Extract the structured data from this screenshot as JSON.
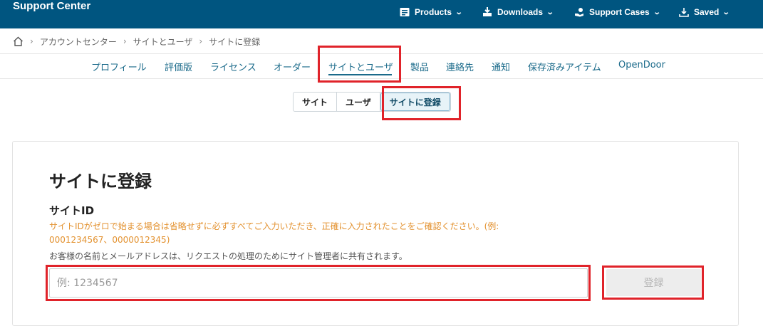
{
  "brand": "Support Center",
  "top_nav": [
    {
      "label": "Products",
      "icon": "product-list-icon"
    },
    {
      "label": "Downloads",
      "icon": "download-tray-icon"
    },
    {
      "label": "Support Cases",
      "icon": "hand-support-icon"
    },
    {
      "label": "Saved",
      "icon": "saved-download-icon"
    }
  ],
  "breadcrumb": {
    "home_icon": "home-icon",
    "items": [
      "アカウントセンター",
      "サイトとユーザ",
      "サイトに登録"
    ]
  },
  "tabs": [
    "プロフィール",
    "評価版",
    "ライセンス",
    "オーダー",
    "サイトとユーザ",
    "製品",
    "連絡先",
    "通知",
    "保存済みアイテム",
    "OpenDoor"
  ],
  "active_tab": "サイトとユーザ",
  "segments": [
    "サイト",
    "ユーザ",
    "サイトに登録"
  ],
  "active_segment": "サイトに登録",
  "form": {
    "title": "サイトに登録",
    "field_label": "サイトID",
    "warning_line1": "サイトIDがゼロで始まる場合は省略せずに必ずすべてご入力いただき、正確に入力されたことをご確認ください。(例:",
    "warning_line2": "0001234567、0000012345)",
    "info": "お客様の名前とメールアドレスは、リクエストの処理のためにサイト管理者に共有されます。",
    "input_placeholder": "例: 1234567",
    "input_value": "",
    "submit_label": "登録"
  },
  "colors": {
    "header_bg": "#005580",
    "accent": "#1a6a8a",
    "warning": "#e39230",
    "highlight": "#e0232a"
  }
}
